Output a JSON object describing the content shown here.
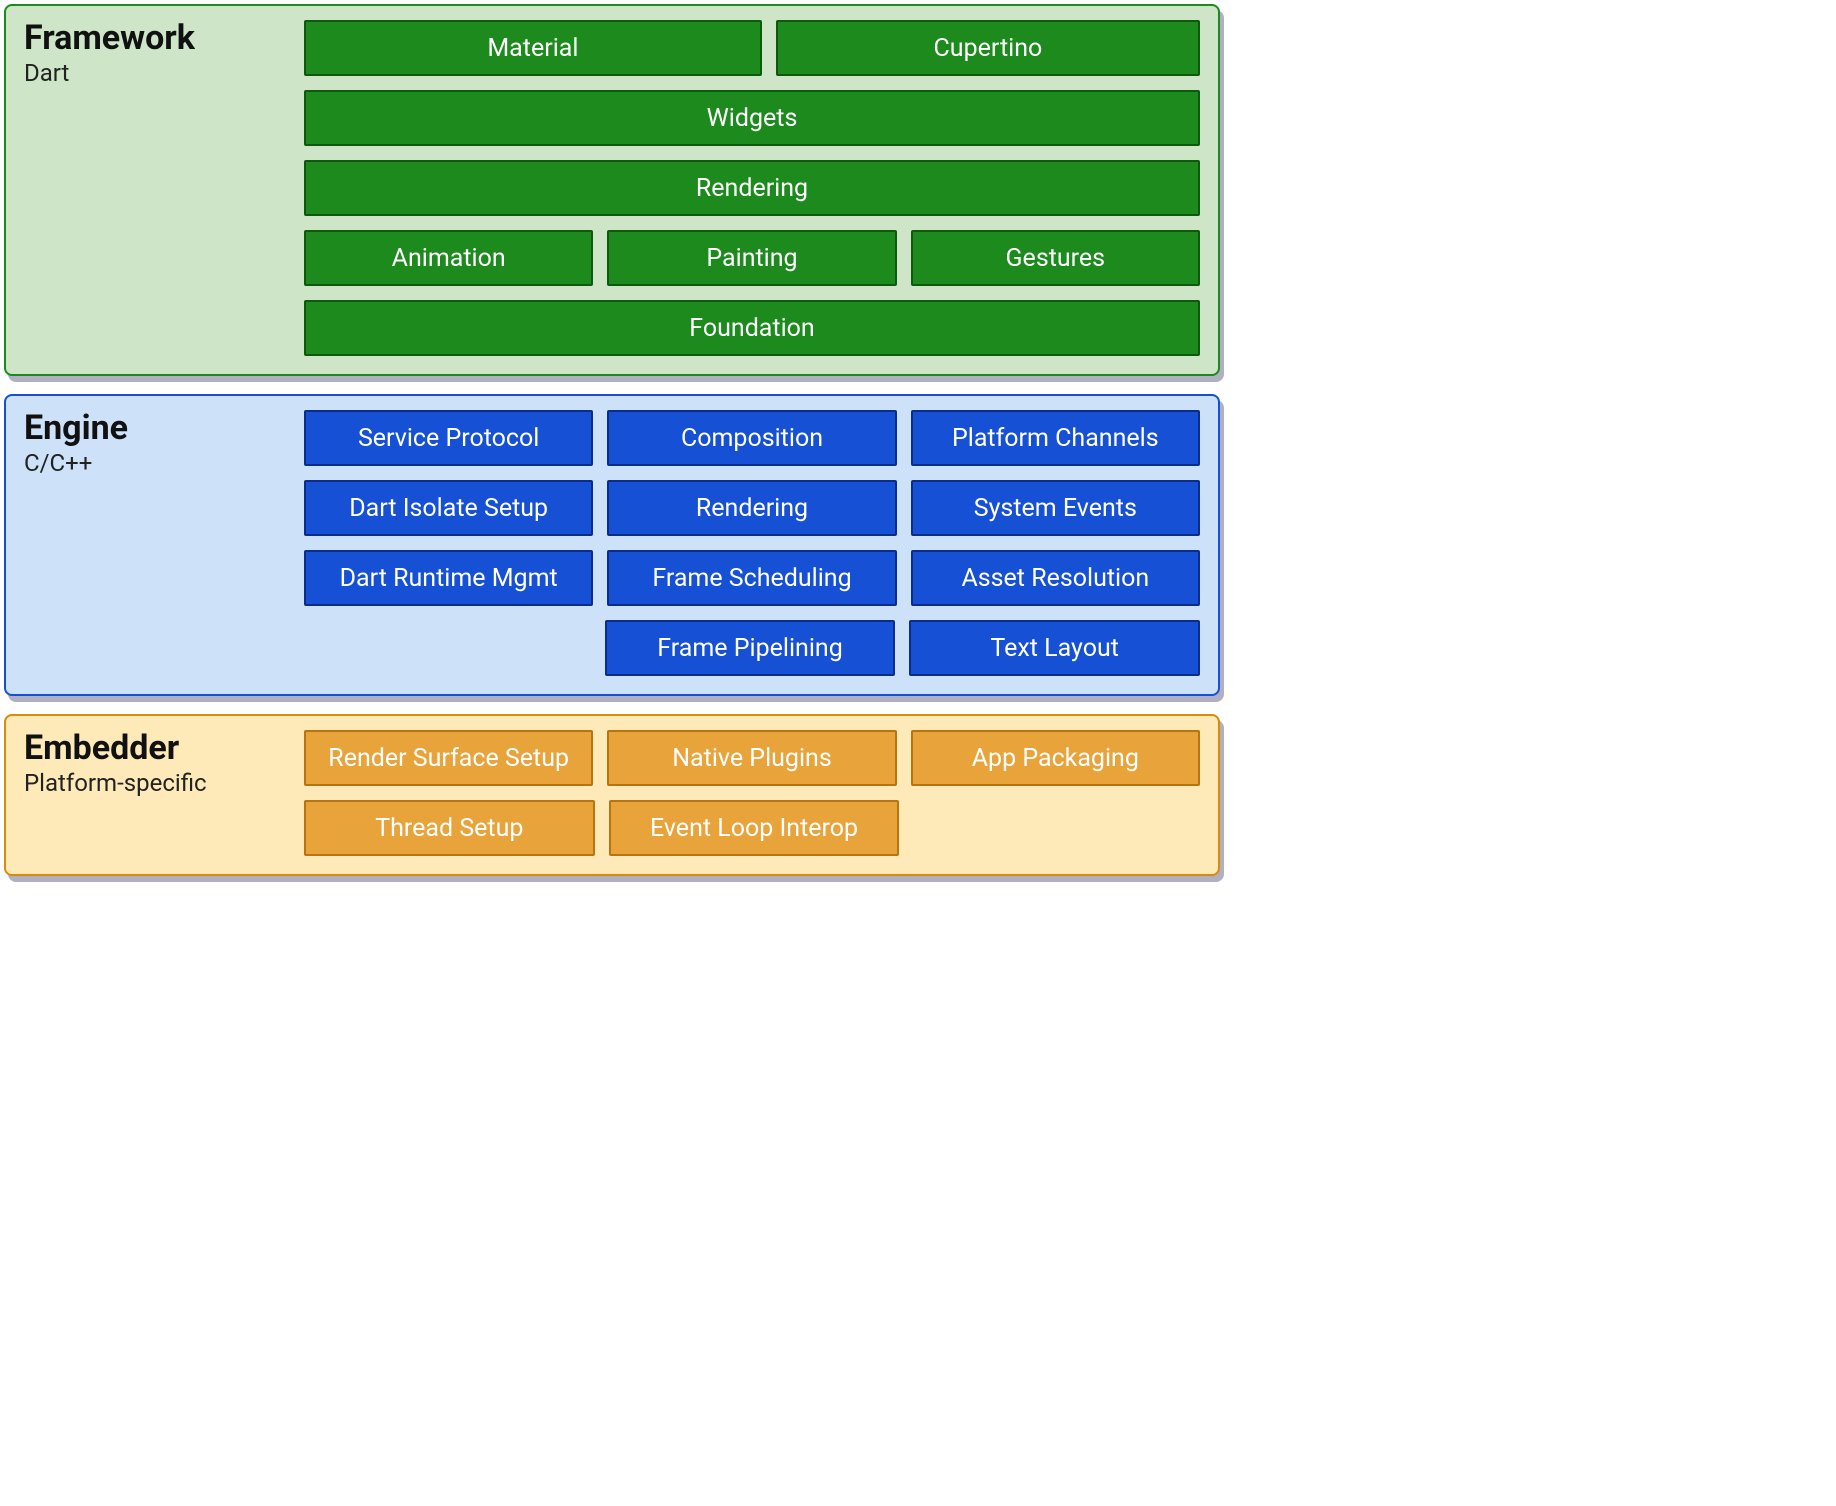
{
  "layers": [
    {
      "id": "framework",
      "title": "Framework",
      "subtitle": "Dart",
      "color": "green",
      "rows": [
        {
          "items": [
            {
              "label": "Material",
              "weight": "wide"
            },
            {
              "label": "Cupertino"
            }
          ]
        },
        {
          "items": [
            {
              "label": "Widgets"
            }
          ]
        },
        {
          "items": [
            {
              "label": "Rendering"
            }
          ]
        },
        {
          "items": [
            {
              "label": "Animation"
            },
            {
              "label": "Painting"
            },
            {
              "label": "Gestures"
            }
          ]
        },
        {
          "items": [
            {
              "label": "Foundation"
            }
          ]
        }
      ]
    },
    {
      "id": "engine",
      "title": "Engine",
      "subtitle": "C/C++",
      "color": "blue",
      "rows": [
        {
          "items": [
            {
              "label": "Service Protocol"
            },
            {
              "label": "Composition"
            },
            {
              "label": "Platform Channels"
            }
          ]
        },
        {
          "items": [
            {
              "label": "Dart Isolate Setup"
            },
            {
              "label": "Rendering"
            },
            {
              "label": "System Events"
            }
          ]
        },
        {
          "items": [
            {
              "label": "Dart Runtime Mgmt"
            },
            {
              "label": "Frame Scheduling"
            },
            {
              "label": "Asset Resolution"
            }
          ]
        },
        {
          "items": [
            {
              "spacer": true
            },
            {
              "label": "Frame Pipelining"
            },
            {
              "label": "Text Layout"
            }
          ]
        }
      ]
    },
    {
      "id": "embedder",
      "title": "Embedder",
      "subtitle": "Platform-specific",
      "color": "orange",
      "rows": [
        {
          "items": [
            {
              "label": "Render Surface Setup"
            },
            {
              "label": "Native Plugins"
            },
            {
              "label": "App Packaging"
            }
          ]
        },
        {
          "items": [
            {
              "label": "Thread Setup"
            },
            {
              "label": "Event Loop Interop"
            },
            {
              "spacer": true
            }
          ]
        }
      ]
    }
  ]
}
